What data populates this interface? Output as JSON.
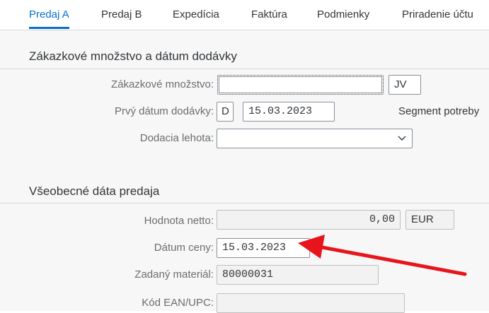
{
  "tabs": [
    "Predaj A",
    "Predaj B",
    "Expedícia",
    "Faktúra",
    "Podmienky",
    "Priradenie účtu"
  ],
  "section1": {
    "title": "Zákazkové množstvo a dátum dodávky",
    "qty_label": "Zákazkové množstvo:",
    "qty_value": "",
    "qty_unit": "JV",
    "date_label": "Prvý dátum dodávky:",
    "date_type": "D",
    "date_value": "15.03.2023",
    "segment_label": "Segment potreby",
    "lead_label": "Dodacia lehota:",
    "lead_value": ""
  },
  "section2": {
    "title": "Všeobecné dáta predaja",
    "net_label": "Hodnota netto:",
    "net_value": "0,00",
    "net_currency": "EUR",
    "price_date_label": "Dátum ceny:",
    "price_date_value": "15.03.2023",
    "material_label": "Zadaný materiál:",
    "material_value": "80000031",
    "ean_label": "Kód EAN/UPC:",
    "ean_value": ""
  },
  "colors": {
    "accent": "#0a6ed1",
    "annotation_arrow": "#e8141c"
  },
  "icons": {
    "dropdown": "chevron-down-icon",
    "annotation": "red-arrow"
  }
}
